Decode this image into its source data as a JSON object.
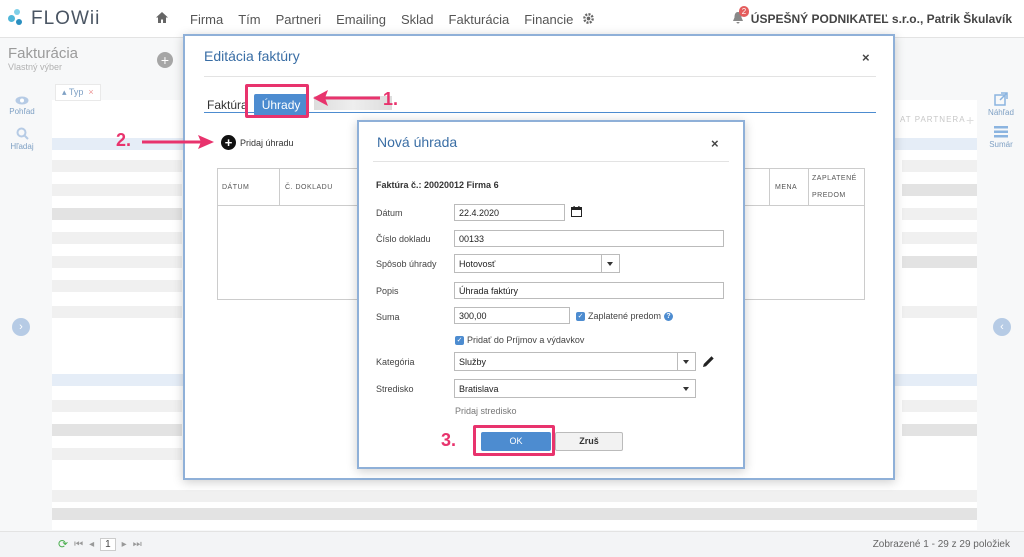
{
  "app": {
    "logo_text": "FLOWii"
  },
  "menu": [
    "Firma",
    "Tím",
    "Partneri",
    "Emailing",
    "Sklad",
    "Fakturácia",
    "Financie"
  ],
  "user": {
    "notifications": "2",
    "name": "ÚSPEŠNÝ PODNIKATEĽ s.r.o., Patrik Škulavík"
  },
  "page": {
    "title": "Fakturácia",
    "subtitle": "Vlastný výber",
    "filter_label": "Typ",
    "filter_remove": "×",
    "add_label": "+"
  },
  "left_tools": [
    {
      "label": "Pohľad",
      "icon": "eye-icon"
    },
    {
      "label": "Hľadaj",
      "icon": "search-icon"
    }
  ],
  "right_tools": [
    {
      "label": "Náhľad",
      "icon": "external-link-icon"
    },
    {
      "label": "Sumár",
      "icon": "list-icon"
    }
  ],
  "grid": {
    "right_header_fragment": "AT PARTNERA"
  },
  "footer": {
    "page": "1",
    "info": "Zobrazené 1 - 29 z 29 položiek"
  },
  "edit_modal": {
    "title": "Editácia faktúry",
    "close": "×",
    "tabs": [
      "Faktúra",
      "Úhrady"
    ],
    "add_payment": "Pridaj úhradu",
    "table_headers": {
      "date": "DÁTUM",
      "doc_no": "Č. DOKLADU",
      "currency": "MENA",
      "prepaid_1": "ZAPLATENÉ",
      "prepaid_2": "PREDOM"
    }
  },
  "pay_modal": {
    "title": "Nová úhrada",
    "close": "×",
    "invoice_ref": "Faktúra č.: 20020012 Firma 6",
    "fields": {
      "date_label": "Dátum",
      "date_value": "22.4.2020",
      "doc_label": "Číslo dokladu",
      "doc_value": "00133",
      "method_label": "Spôsob úhrady",
      "method_value": "Hotovosť",
      "desc_label": "Popis",
      "desc_value": "Úhrada faktúry",
      "sum_label": "Suma",
      "sum_value": "300,00",
      "prepaid_label": "Zaplatené predom",
      "add_income_label": "Pridať do Príjmov a výdavkov",
      "category_label": "Kategória",
      "category_value": "Služby",
      "center_label": "Stredisko",
      "center_value": "Bratislava",
      "add_center_link": "Pridaj stredisko"
    },
    "ok": "OK",
    "cancel": "Zruš"
  },
  "annotations": {
    "step1": "1.",
    "step2": "2.",
    "step3": "3."
  },
  "colors": {
    "accent": "#4d8cd0",
    "annotation": "#e8336d",
    "title_blue": "#3a6ea5"
  }
}
